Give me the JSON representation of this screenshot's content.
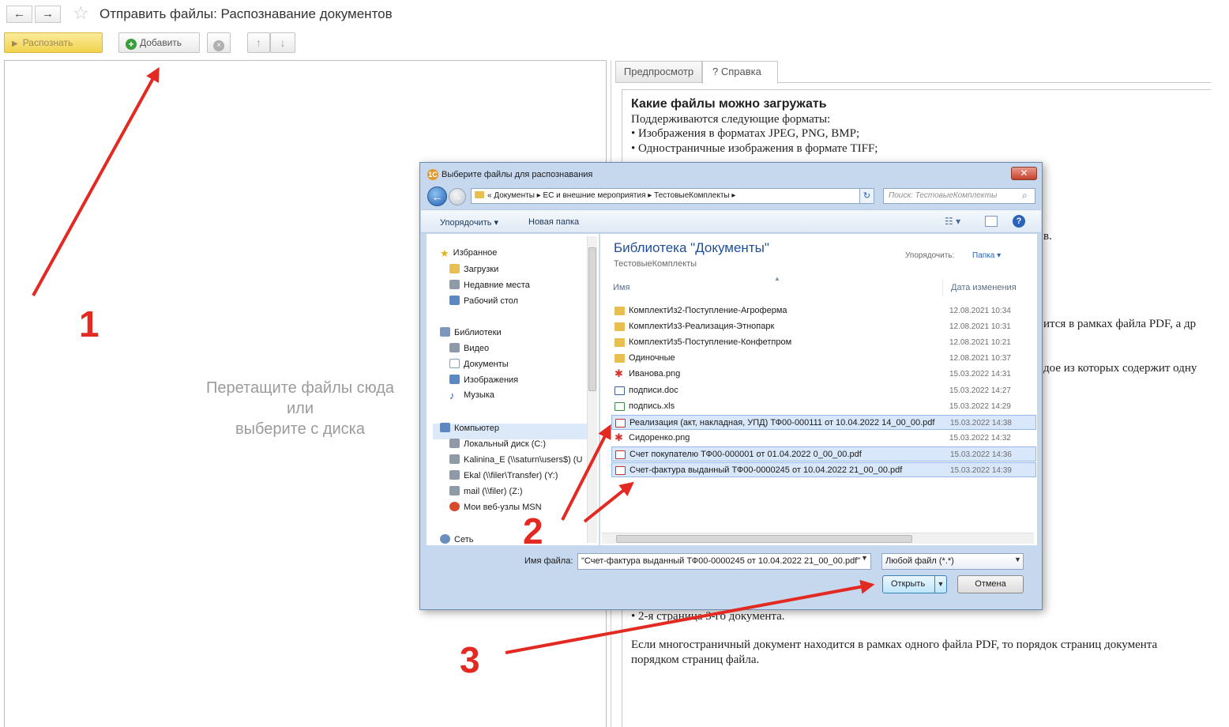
{
  "window": {
    "title": "Отправить файлы: Распознавание документов",
    "back_icon": "←",
    "forward_icon": "→",
    "star_icon": "☆"
  },
  "toolbar": {
    "recognize_label": "Распознать",
    "add_label": "Добавить",
    "remove_icon": "×",
    "up_icon": "🡅",
    "down_icon": "🡇"
  },
  "dropzone": {
    "line1": "Перетащите файлы сюда",
    "line2": "или",
    "line3": "выберите с диска"
  },
  "help_tabs": {
    "preview": "Предпросмотр",
    "help": "? Справка"
  },
  "help": {
    "heading": "Какие файлы можно загружать",
    "line1": "Поддерживаются следующие форматы:",
    "line2": "• Изображения в форматах JPEG, PNG, BMP;",
    "line3": "• Одностраничные изображения в формате TIFF;",
    "fragment_v": "в.",
    "fragment_pdf": "ится в рамках файла PDF, а др",
    "fragment_each": "дое из которых содержит одну",
    "line_page2": "• 2-я страница 3-го документа.",
    "para_line1": "Если многостраничный документ находится в рамках одного файла PDF, то порядок страниц документа",
    "para_line2": "порядком страниц файла."
  },
  "dialog": {
    "title": "Выберите файлы для распознавания",
    "close_icon": "✕",
    "address": "« Документы ▸ ЕС и внешние мероприятия ▸ ТестовыеКомплекты ▸",
    "search_placeholder": "Поиск: ТестовыеКомплекты",
    "search_icon": "⌕",
    "organize_label": "Упорядочить ▾",
    "new_folder_label": "Новая папка",
    "help_icon": "?",
    "library_title": "Библиотека \"Документы\"",
    "library_subtitle": "ТестовыеКомплекты",
    "arrange_label": "Упорядочить:",
    "arrange_value": "Папка ▾",
    "col_name": "Имя",
    "col_date": "Дата изменения",
    "file_name_label": "Имя файла:",
    "file_name_value": "\"Счет-фактура выданный ТФ00-0000245 от 10.04.2022 21_00_00.pdf\"",
    "file_type_value": "Любой файл (*.*)",
    "open_label": "Открыть",
    "cancel_label": "Отмена",
    "nav": {
      "favorites": "Избранное",
      "downloads": "Загрузки",
      "recent": "Недавние места",
      "desktop": "Рабочий стол",
      "libraries": "Библиотеки",
      "video": "Видео",
      "documents": "Документы",
      "images": "Изображения",
      "music": "Музыка",
      "computer": "Компьютер",
      "local_disk": "Локальный диск (C:)",
      "kalinina": "Kalinina_E (\\\\saturn\\users$) (U",
      "ekal": "Ekal (\\\\filer\\Transfer) (Y:)",
      "mail": "mail (\\\\filer) (Z:)",
      "msn": "Мои веб-узлы MSN",
      "network": "Сеть"
    },
    "files": [
      {
        "name": "КомплектИз2-Поступление-Агроферма",
        "date": "12.08.2021 10:34",
        "type": "folder",
        "selected": false
      },
      {
        "name": "КомплектИз3-Реализация-Этнопарк",
        "date": "12.08.2021 10:31",
        "type": "folder",
        "selected": false
      },
      {
        "name": "КомплектИз5-Поступление-Конфетпром",
        "date": "12.08.2021 10:21",
        "type": "folder",
        "selected": false
      },
      {
        "name": "Одиночные",
        "date": "12.08.2021 10:37",
        "type": "folder",
        "selected": false
      },
      {
        "name": "Иванова.png",
        "date": "15.03.2022 14:31",
        "type": "png",
        "selected": false
      },
      {
        "name": "подписи.doc",
        "date": "15.03.2022 14:27",
        "type": "doc",
        "selected": false
      },
      {
        "name": "подпись.xls",
        "date": "15.03.2022 14:29",
        "type": "xls",
        "selected": false
      },
      {
        "name": "Реализация (акт, накладная, УПД) ТФ00-000111 от 10.04.2022 14_00_00.pdf",
        "date": "15.03.2022 14:38",
        "type": "pdf",
        "selected": true
      },
      {
        "name": "Сидоренко.png",
        "date": "15.03.2022 14:32",
        "type": "png",
        "selected": false
      },
      {
        "name": "Счет покупателю ТФ00-000001 от 01.04.2022 0_00_00.pdf",
        "date": "15.03.2022 14:36",
        "type": "pdf",
        "selected": true
      },
      {
        "name": "Счет-фактура выданный ТФ00-0000245 от 10.04.2022 21_00_00.pdf",
        "date": "15.03.2022 14:39",
        "type": "pdf",
        "selected": true
      }
    ]
  },
  "annotations": {
    "step1": "1",
    "step2": "2",
    "step3": "3",
    "arrow_color": "#e32a22"
  }
}
